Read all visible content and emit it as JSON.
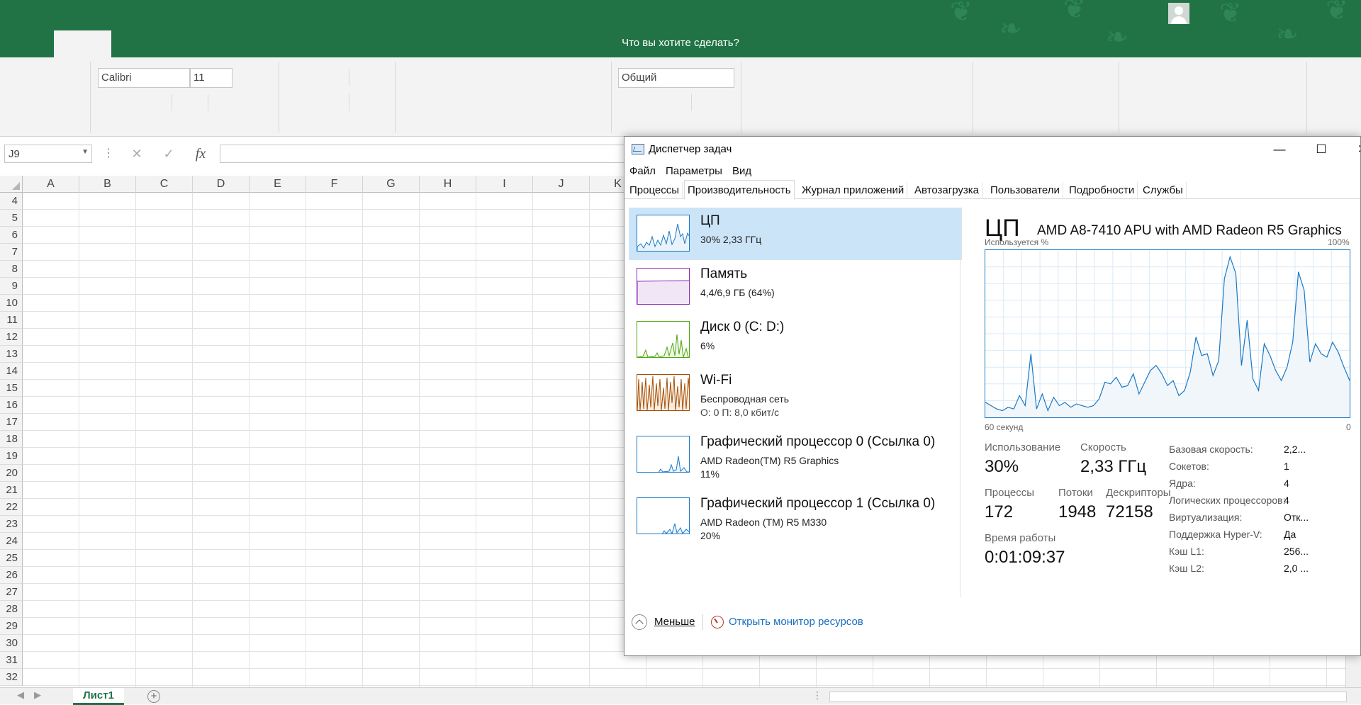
{
  "excel": {
    "tell_me": "Что вы хотите сделать?",
    "font_name": "Calibri",
    "font_size": "11",
    "number_format": "Общий",
    "name_box": "J9",
    "columns": [
      "A",
      "B",
      "C",
      "D",
      "E",
      "F",
      "G",
      "H",
      "I",
      "J",
      "K"
    ],
    "rows": [
      "4",
      "5",
      "6",
      "7",
      "8",
      "9",
      "10",
      "11",
      "12",
      "13",
      "14",
      "15",
      "16",
      "17",
      "18",
      "19",
      "20",
      "21",
      "22",
      "23",
      "24",
      "25",
      "26",
      "27",
      "28",
      "29",
      "30",
      "31",
      "32"
    ],
    "sheet_tab": "Лист1"
  },
  "tm": {
    "title": "Диспетчер задач",
    "menu": [
      "Файл",
      "Параметры",
      "Вид"
    ],
    "tabs": [
      "Процессы",
      "Производительность",
      "Журнал приложений",
      "Автозагрузка",
      "Пользователи",
      "Подробности",
      "Службы"
    ],
    "active_tab": "Производительность",
    "resources": [
      {
        "name": "ЦП",
        "line1": "30%  2,33 ГГц",
        "line2": "",
        "color": "#1979c6"
      },
      {
        "name": "Память",
        "line1": "4,4/6,9 ГБ (64%)",
        "line2": "",
        "color": "#8b29b6"
      },
      {
        "name": "Диск 0 (C: D:)",
        "line1": "6%",
        "line2": "",
        "color": "#4da60c"
      },
      {
        "name": "Wi-Fi",
        "line1": "Беспроводная сеть",
        "line2": "О: 0  П: 8,0 кбит/с",
        "color": "#a74f01"
      },
      {
        "name": "Графический процессор 0 (Ссылка 0)",
        "line1": "AMD Radeon(TM) R5 Graphics",
        "line2": "11%",
        "color": "#1979c6"
      },
      {
        "name": "Графический процессор 1 (Ссылка 0)",
        "line1": "AMD Radeon (TM) R5 M330",
        "line2": "20%",
        "color": "#1979c6"
      }
    ],
    "cpu": {
      "heading": "ЦП",
      "model": "AMD A8-7410 APU with AMD Radeon R5 Graphics",
      "graph_top_left": "Используется %",
      "graph_top_right": "100%",
      "graph_bottom_left": "60 секунд",
      "graph_bottom_right": "0",
      "usage_label": "Использование",
      "usage": "30%",
      "speed_label": "Скорость",
      "speed": "2,33 ГГц",
      "processes_label": "Процессы",
      "processes": "172",
      "threads_label": "Потоки",
      "threads": "1948",
      "handles_label": "Дескрипторы",
      "handles": "72158",
      "uptime_label": "Время работы",
      "uptime": "0:01:09:37",
      "details": [
        {
          "k": "Базовая скорость:",
          "v": "2,2..."
        },
        {
          "k": "Сокетов:",
          "v": "1"
        },
        {
          "k": "Ядра:",
          "v": "4"
        },
        {
          "k": "Логических процессоров:",
          "v": "4"
        },
        {
          "k": "Виртуализация:",
          "v": "Отк..."
        },
        {
          "k": "Поддержка Hyper-V:",
          "v": "Да"
        },
        {
          "k": "Кэш L1:",
          "v": "256..."
        },
        {
          "k": "Кэш L2:",
          "v": "2,0 ..."
        }
      ],
      "history": [
        9,
        7,
        5,
        4,
        6,
        5,
        13,
        7,
        38,
        5,
        14,
        4,
        12,
        7,
        9,
        6,
        8,
        7,
        6,
        7,
        11,
        21,
        20,
        24,
        18,
        19,
        26,
        14,
        21,
        28,
        31,
        26,
        19,
        22,
        13,
        16,
        27,
        48,
        37,
        38,
        25,
        34,
        83,
        96,
        86,
        31,
        58,
        23,
        16,
        44,
        37,
        28,
        22,
        30,
        45,
        87,
        76,
        33,
        44,
        38,
        36,
        45,
        39,
        30,
        22
      ]
    },
    "footer": {
      "fewer": "Меньше",
      "resmon": "Открыть монитор ресурсов"
    }
  }
}
